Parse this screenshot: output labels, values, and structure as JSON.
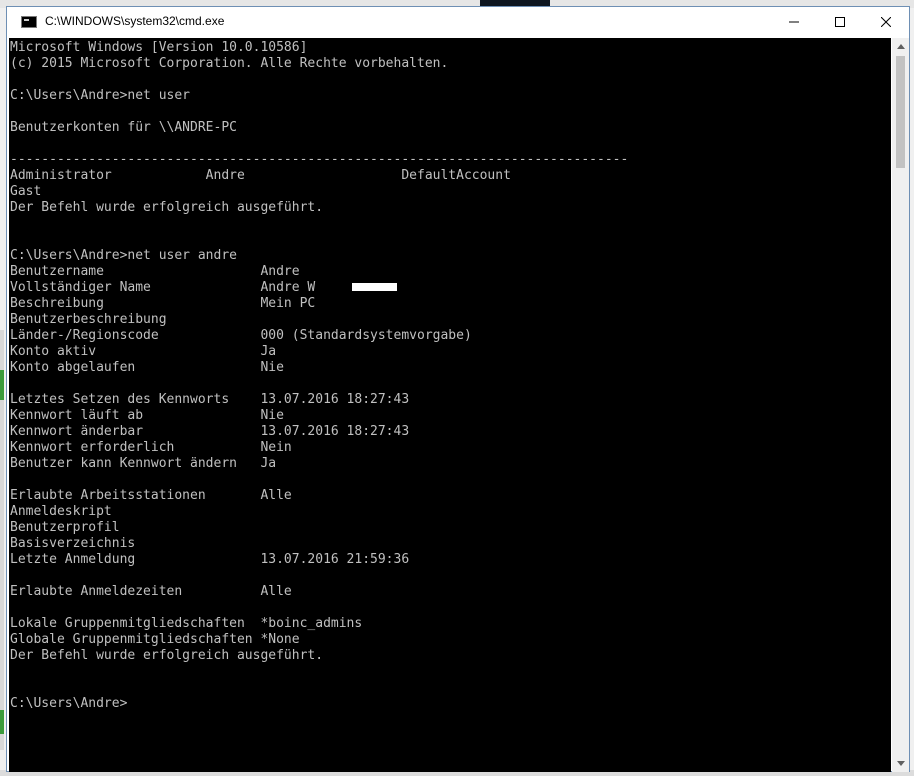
{
  "window": {
    "title": "C:\\WINDOWS\\system32\\cmd.exe",
    "minimize_icon": "minimize-icon",
    "maximize_icon": "maximize-icon",
    "close_icon": "close-icon"
  },
  "console": {
    "lines": [
      "Microsoft Windows [Version 10.0.10586]",
      "(c) 2015 Microsoft Corporation. Alle Rechte vorbehalten.",
      "",
      "C:\\Users\\Andre>net user",
      "",
      "Benutzerkonten für \\\\ANDRE-PC",
      "",
      "-------------------------------------------------------------------------------",
      "Administrator            Andre                    DefaultAccount",
      "Gast",
      "Der Befehl wurde erfolgreich ausgeführt.",
      "",
      "",
      "C:\\Users\\Andre>net user andre",
      "Benutzername                    Andre",
      "Vollständiger Name              Andre W",
      "Beschreibung                    Mein PC",
      "Benutzerbeschreibung",
      "Länder-/Regionscode             000 (Standardsystemvorgabe)",
      "Konto aktiv                     Ja",
      "Konto abgelaufen                Nie",
      "",
      "Letztes Setzen des Kennworts    13.07.2016 18:27:43",
      "Kennwort läuft ab               Nie",
      "Kennwort änderbar               13.07.2016 18:27:43",
      "Kennwort erforderlich           Nein",
      "Benutzer kann Kennwort ändern   Ja",
      "",
      "Erlaubte Arbeitsstationen       Alle",
      "Anmeldeskript",
      "Benutzerprofil",
      "Basisverzeichnis",
      "Letzte Anmeldung                13.07.2016 21:59:36",
      "",
      "Erlaubte Anmeldezeiten          Alle",
      "",
      "Lokale Gruppenmitgliedschaften  *boinc_admins",
      "Globale Gruppenmitgliedschaften *None",
      "Der Befehl wurde erfolgreich ausgeführt.",
      "",
      "",
      "C:\\Users\\Andre>"
    ]
  },
  "colors": {
    "console_background": "#000000",
    "console_text": "#c0c0c0"
  }
}
